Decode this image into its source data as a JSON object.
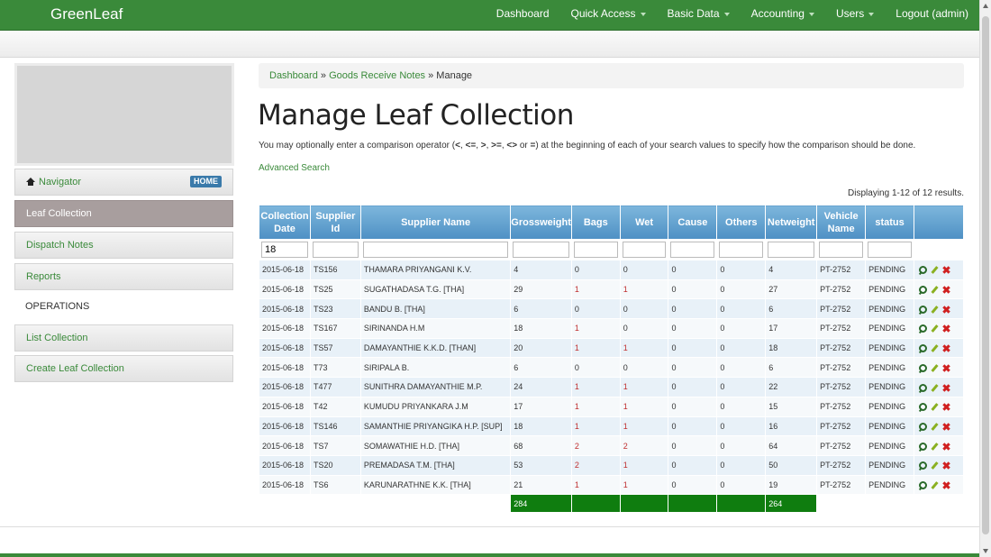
{
  "brand": "GreenLeaf",
  "nav": {
    "items": [
      {
        "label": "Dashboard",
        "dropdown": false
      },
      {
        "label": "Quick Access",
        "dropdown": true
      },
      {
        "label": "Basic Data",
        "dropdown": true
      },
      {
        "label": "Accounting",
        "dropdown": true
      },
      {
        "label": "Users",
        "dropdown": true
      },
      {
        "label": "Logout (admin)",
        "dropdown": false
      }
    ]
  },
  "sidebar": {
    "navigator": {
      "label": "Navigator",
      "badge": "HOME"
    },
    "items": [
      {
        "label": "Leaf Collection"
      },
      {
        "label": "Dispatch Notes"
      },
      {
        "label": "Reports"
      }
    ],
    "operations_heading": "OPERATIONS",
    "operations": [
      {
        "label": "List Collection"
      },
      {
        "label": "Create Leaf Collection"
      }
    ]
  },
  "breadcrumb": {
    "dashboard": "Dashboard",
    "sep1": " » ",
    "grn": "Goods Receive Notes",
    "sep2": " » ",
    "current": "Manage"
  },
  "page": {
    "title": "Manage Leaf Collection",
    "note_prefix": "You may optionally enter a comparison operator (",
    "op1": "<",
    "op2": "<=",
    "op3": ">",
    "op4": ">=",
    "op5": "<>",
    "op6": "=",
    "note_suffix": ") at the beginning of each of your search values to specify how the comparison should be done.",
    "sep": ", ",
    "or": " or ",
    "advanced_search": "Advanced Search",
    "summary": "Displaying 1-12 of 12 results."
  },
  "table": {
    "headers": [
      "Collection Date",
      "Supplier Id",
      "Supplier Name",
      "Grossweight",
      "Bags",
      "Wet",
      "Cause",
      "Others",
      "Netweight",
      "Vehicle Name",
      "status"
    ],
    "filter_values": [
      "18",
      "",
      "",
      "",
      "",
      "",
      "",
      "",
      "",
      "",
      ""
    ],
    "rows": [
      [
        "2015-06-18",
        "TS156",
        "THAMARA PRIYANGANI K.V.",
        "4",
        "0",
        "0",
        "0",
        "0",
        "4",
        "PT-2752",
        "PENDING"
      ],
      [
        "2015-06-18",
        "TS25",
        "SUGATHADASA T.G. [THA]",
        "29",
        "1",
        "1",
        "0",
        "0",
        "27",
        "PT-2752",
        "PENDING"
      ],
      [
        "2015-06-18",
        "TS23",
        "BANDU B. [THA]",
        "6",
        "0",
        "0",
        "0",
        "0",
        "6",
        "PT-2752",
        "PENDING"
      ],
      [
        "2015-06-18",
        "TS167",
        "SIRINANDA H.M",
        "18",
        "1",
        "0",
        "0",
        "0",
        "17",
        "PT-2752",
        "PENDING"
      ],
      [
        "2015-06-18",
        "TS57",
        "DAMAYANTHIE K.K.D. [THAN]",
        "20",
        "1",
        "1",
        "0",
        "0",
        "18",
        "PT-2752",
        "PENDING"
      ],
      [
        "2015-06-18",
        "T73",
        "SIRIPALA B.",
        "6",
        "0",
        "0",
        "0",
        "0",
        "6",
        "PT-2752",
        "PENDING"
      ],
      [
        "2015-06-18",
        "T477",
        "SUNITHRA DAMAYANTHIE M.P.",
        "24",
        "1",
        "1",
        "0",
        "0",
        "22",
        "PT-2752",
        "PENDING"
      ],
      [
        "2015-06-18",
        "T42",
        "KUMUDU PRIYANKARA J.M",
        "17",
        "1",
        "1",
        "0",
        "0",
        "15",
        "PT-2752",
        "PENDING"
      ],
      [
        "2015-06-18",
        "TS146",
        "SAMANTHIE PRIYANGIKA H.P. [SUP]",
        "18",
        "1",
        "1",
        "0",
        "0",
        "16",
        "PT-2752",
        "PENDING"
      ],
      [
        "2015-06-18",
        "TS7",
        "SOMAWATHIE H.D. [THA]",
        "68",
        "2",
        "2",
        "0",
        "0",
        "64",
        "PT-2752",
        "PENDING"
      ],
      [
        "2015-06-18",
        "TS20",
        "PREMADASA T.M. [THA]",
        "53",
        "2",
        "1",
        "0",
        "0",
        "50",
        "PT-2752",
        "PENDING"
      ],
      [
        "2015-06-18",
        "TS6",
        "KARUNARATHNE K.K. [THA]",
        "21",
        "1",
        "1",
        "0",
        "0",
        "19",
        "PT-2752",
        "PENDING"
      ]
    ],
    "totals": {
      "grossweight": "284",
      "netweight": "264"
    }
  },
  "colors": {
    "brand_green": "#3a8a3a",
    "header_blue": "#4e90c4",
    "total_green": "#0f7d0f"
  }
}
